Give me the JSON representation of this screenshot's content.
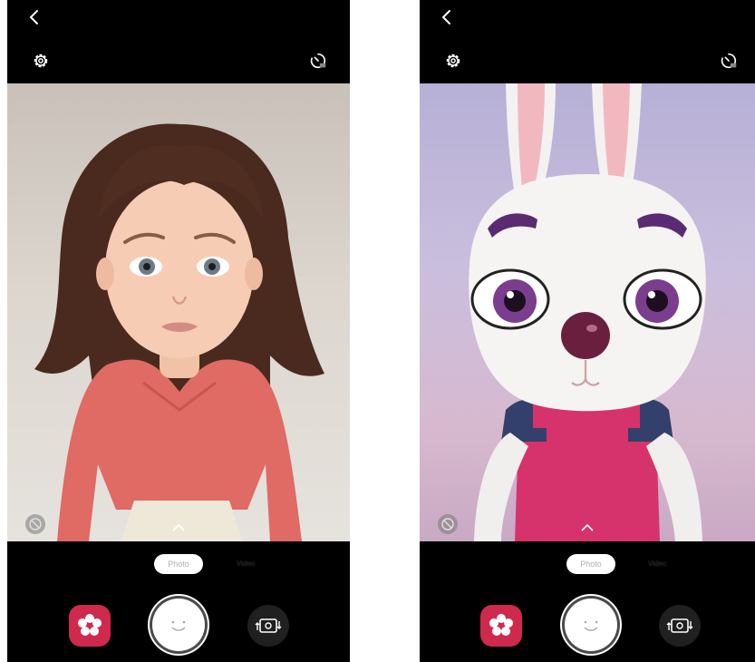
{
  "screens": [
    {
      "id": "left",
      "mode": {
        "active_label": "Photo",
        "other_label": "Video"
      },
      "icons": [
        "back-icon",
        "settings-gear-icon",
        "timer-icon",
        "no-sticker-icon",
        "chevron-up-icon",
        "sticker-flower-icon",
        "smiley-shutter-icon",
        "switch-camera-icon"
      ],
      "colors": {
        "accent": "#cf2a4d",
        "background": "#000000"
      }
    },
    {
      "id": "right",
      "mode": {
        "active_label": "Photo",
        "other_label": "Video"
      },
      "icons": [
        "back-icon",
        "settings-gear-icon",
        "timer-icon",
        "no-sticker-icon",
        "chevron-up-icon",
        "sticker-flower-icon",
        "smiley-shutter-icon",
        "switch-camera-icon"
      ],
      "colors": {
        "accent": "#cf2a4d",
        "background": "#000000"
      }
    }
  ]
}
